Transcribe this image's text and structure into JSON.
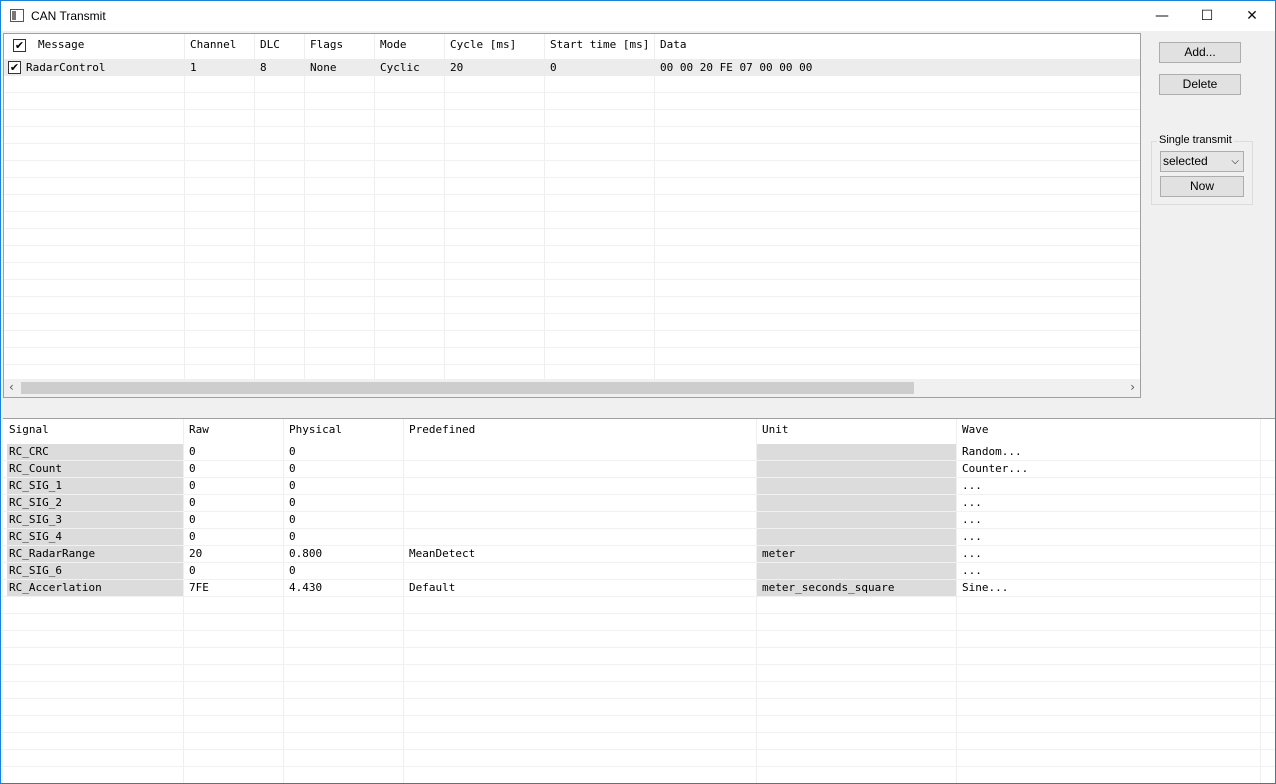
{
  "window": {
    "title": "CAN Transmit",
    "controls": {
      "minimize": "—",
      "maximize": "☐",
      "close": "✕"
    }
  },
  "messages_table": {
    "headers": [
      "Message",
      "Channel",
      "DLC",
      "Flags",
      "Mode",
      "Cycle [ms]",
      "Start time [ms]",
      "Data"
    ],
    "header_checkbox": "✔",
    "rows": [
      {
        "checked": "✔",
        "message": "RadarControl",
        "channel": "1",
        "dlc": "8",
        "flags": "None",
        "mode": "Cyclic",
        "cycle": "20",
        "start_time": "0",
        "data": "00 00 20 FE 07 00 00 00"
      }
    ],
    "scroll_left": "‹",
    "scroll_right": "›"
  },
  "side_panel": {
    "add_label": "Add...",
    "delete_label": "Delete",
    "single_transmit_title": "Single transmit",
    "single_transmit_value": "selected",
    "dropdown_icon": "⌵",
    "now_label": "Now"
  },
  "signals_table": {
    "headers": [
      "Signal",
      "Raw",
      "Physical",
      "Predefined",
      "Unit",
      "Wave"
    ],
    "rows": [
      {
        "signal": "RC_CRC",
        "raw": "0",
        "physical": "0",
        "predefined": "",
        "unit": "",
        "wave": "Random..."
      },
      {
        "signal": "RC_Count",
        "raw": "0",
        "physical": "0",
        "predefined": "",
        "unit": "",
        "wave": "Counter..."
      },
      {
        "signal": "RC_SIG_1",
        "raw": "0",
        "physical": "0",
        "predefined": "",
        "unit": "",
        "wave": "..."
      },
      {
        "signal": "RC_SIG_2",
        "raw": "0",
        "physical": "0",
        "predefined": "",
        "unit": "",
        "wave": "..."
      },
      {
        "signal": "RC_SIG_3",
        "raw": "0",
        "physical": "0",
        "predefined": "",
        "unit": "",
        "wave": "..."
      },
      {
        "signal": "RC_SIG_4",
        "raw": "0",
        "physical": "0",
        "predefined": "",
        "unit": "",
        "wave": "..."
      },
      {
        "signal": "RC_RadarRange",
        "raw": "20",
        "physical": "0.800",
        "predefined": "MeanDetect",
        "unit": "meter",
        "wave": "..."
      },
      {
        "signal": "RC_SIG_6",
        "raw": "0",
        "physical": "0",
        "predefined": "",
        "unit": "",
        "wave": "..."
      },
      {
        "signal": "RC_Accerlation",
        "raw": "7FE",
        "physical": "4.430",
        "predefined": "Default",
        "unit": "meter_seconds_square",
        "wave": "Sine..."
      }
    ]
  }
}
